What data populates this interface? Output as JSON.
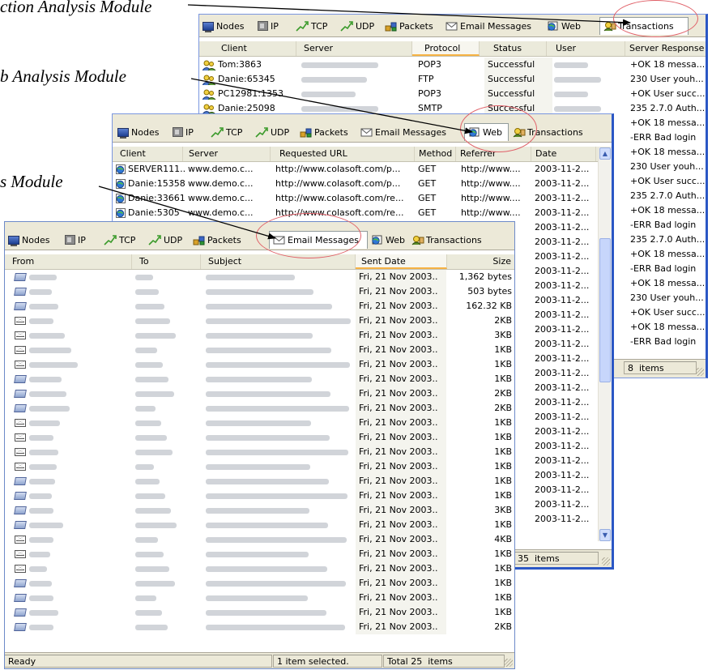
{
  "captions": {
    "transaction": "ction Analysis Module",
    "web": "b Analysis Module",
    "email": "s Module"
  },
  "tabs": {
    "nodes": "Nodes",
    "ip": "IP",
    "tcp": "TCP",
    "udp": "UDP",
    "packets": "Packets",
    "email": "Email Messages",
    "web": "Web",
    "transactions": "Transactions"
  },
  "transactions": {
    "columns": [
      "Client",
      "Server",
      "Protocol",
      "Status",
      "User",
      "Server Response"
    ],
    "rows": [
      {
        "client": "Tom:3863",
        "protocol": "POP3",
        "status": "Successful"
      },
      {
        "client": "Danie:65345",
        "protocol": "FTP",
        "status": "Successful"
      },
      {
        "client": "PC12981:1353",
        "protocol": "POP3",
        "status": "Successful"
      },
      {
        "client": "Danie:25098",
        "protocol": "SMTP",
        "status": "Successful"
      }
    ],
    "responses": [
      "+OK 18 messa...",
      "230 User youh...",
      "+OK User succ...",
      "235 2.7.0 Auth...",
      "+OK 18 messa...",
      "-ERR Bad login",
      "+OK 18 messa...",
      "230 User youh...",
      "+OK User succ...",
      "235 2.7.0 Auth...",
      "+OK 18 messa...",
      "-ERR Bad login",
      "235 2.7.0 Auth...",
      "+OK 18 messa...",
      "-ERR Bad login",
      "+OK 18 messa...",
      "230 User youh...",
      "+OK User succ...",
      "+OK 18 messa...",
      "-ERR Bad login"
    ],
    "status_count": "8",
    "status_items": "items"
  },
  "web": {
    "columns": [
      "Client",
      "Server",
      "Requested URL",
      "Method",
      "Referrer",
      "Date"
    ],
    "rows": [
      {
        "client": "SERVER111...",
        "server": "www.demo.c...",
        "url": "http://www.colasoft.com/p...",
        "method": "GET",
        "referrer": "http://www....",
        "date": "2003-11-2..."
      },
      {
        "client": "Danie:15358",
        "server": "www.demo.c...",
        "url": "http://www.colasoft.com/p...",
        "method": "GET",
        "referrer": "http://www....",
        "date": "2003-11-2..."
      },
      {
        "client": "Danie:33661",
        "server": "www.demo.c...",
        "url": "http://www.colasoft.com/re...",
        "method": "GET",
        "referrer": "http://www....",
        "date": "2003-11-2..."
      },
      {
        "client": "Danie:5305",
        "server": "www.demo.c...",
        "url": "http://www.colasoft.com/re...",
        "method": "GET",
        "referrer": "http://www....",
        "date": "2003-11-2..."
      }
    ],
    "more_dates": [
      "2003-11-2...",
      "2003-11-2...",
      "2003-11-2...",
      "2003-11-2...",
      "2003-11-2...",
      "2003-11-2...",
      "2003-11-2...",
      "2003-11-2...",
      "2003-11-2...",
      "2003-11-2...",
      "2003-11-2...",
      "2003-11-2...",
      "2003-11-2...",
      "2003-11-2...",
      "2003-11-2...",
      "2003-11-2...",
      "2003-11-2...",
      "2003-11-2...",
      "2003-11-2...",
      "2003-11-2...",
      "2003-11-2..."
    ],
    "status_count": "35",
    "status_items": "items"
  },
  "email": {
    "columns": [
      "From",
      "To",
      "Subject",
      "Sent Date",
      "Size"
    ],
    "rows": [
      {
        "date": "Fri, 21 Nov 2003..",
        "size": "1,362 bytes",
        "icon": "new"
      },
      {
        "date": "Fri, 21 Nov 2003..",
        "size": "503 bytes",
        "icon": "new"
      },
      {
        "date": "Fri, 21 Nov 2003..",
        "size": "162.32 KB",
        "icon": "new"
      },
      {
        "date": "Fri, 21 Nov 2003..",
        "size": "2KB",
        "icon": "old"
      },
      {
        "date": "Fri, 21 Nov 2003..",
        "size": "3KB",
        "icon": "old"
      },
      {
        "date": "Fri, 21 Nov 2003..",
        "size": "1KB",
        "icon": "old"
      },
      {
        "date": "Fri, 21 Nov 2003..",
        "size": "1KB",
        "icon": "old"
      },
      {
        "date": "Fri, 21 Nov 2003..",
        "size": "1KB",
        "icon": "new"
      },
      {
        "date": "Fri, 21 Nov 2003..",
        "size": "2KB",
        "icon": "new"
      },
      {
        "date": "Fri, 21 Nov 2003..",
        "size": "2KB",
        "icon": "new"
      },
      {
        "date": "Fri, 21 Nov 2003..",
        "size": "1KB",
        "icon": "old"
      },
      {
        "date": "Fri, 21 Nov 2003..",
        "size": "1KB",
        "icon": "old"
      },
      {
        "date": "Fri, 21 Nov 2003..",
        "size": "1KB",
        "icon": "old"
      },
      {
        "date": "Fri, 21 Nov 2003..",
        "size": "1KB",
        "icon": "old"
      },
      {
        "date": "Fri, 21 Nov 2003..",
        "size": "1KB",
        "icon": "new"
      },
      {
        "date": "Fri, 21 Nov 2003..",
        "size": "1KB",
        "icon": "new"
      },
      {
        "date": "Fri, 21 Nov 2003..",
        "size": "3KB",
        "icon": "new"
      },
      {
        "date": "Fri, 21 Nov 2003..",
        "size": "1KB",
        "icon": "new"
      },
      {
        "date": "Fri, 21 Nov 2003..",
        "size": "4KB",
        "icon": "old"
      },
      {
        "date": "Fri, 21 Nov 2003..",
        "size": "1KB",
        "icon": "old"
      },
      {
        "date": "Fri, 21 Nov 2003..",
        "size": "1KB",
        "icon": "old"
      },
      {
        "date": "Fri, 21 Nov 2003..",
        "size": "1KB",
        "icon": "new"
      },
      {
        "date": "Fri, 21 Nov 2003..",
        "size": "1KB",
        "icon": "new"
      },
      {
        "date": "Fri, 21 Nov 2003..",
        "size": "1KB",
        "icon": "new"
      },
      {
        "date": "Fri, 21 Nov 2003..",
        "size": "2KB",
        "icon": "new"
      }
    ],
    "status": {
      "ready": "Ready",
      "selected": "1 item selected.",
      "total_label": "Total",
      "total_count": "25",
      "total_items": "items"
    }
  },
  "colors": {
    "highlight_oval": "#e06068",
    "window_border": "#2b57c5",
    "tabbar_bg": "#ece9d8"
  }
}
